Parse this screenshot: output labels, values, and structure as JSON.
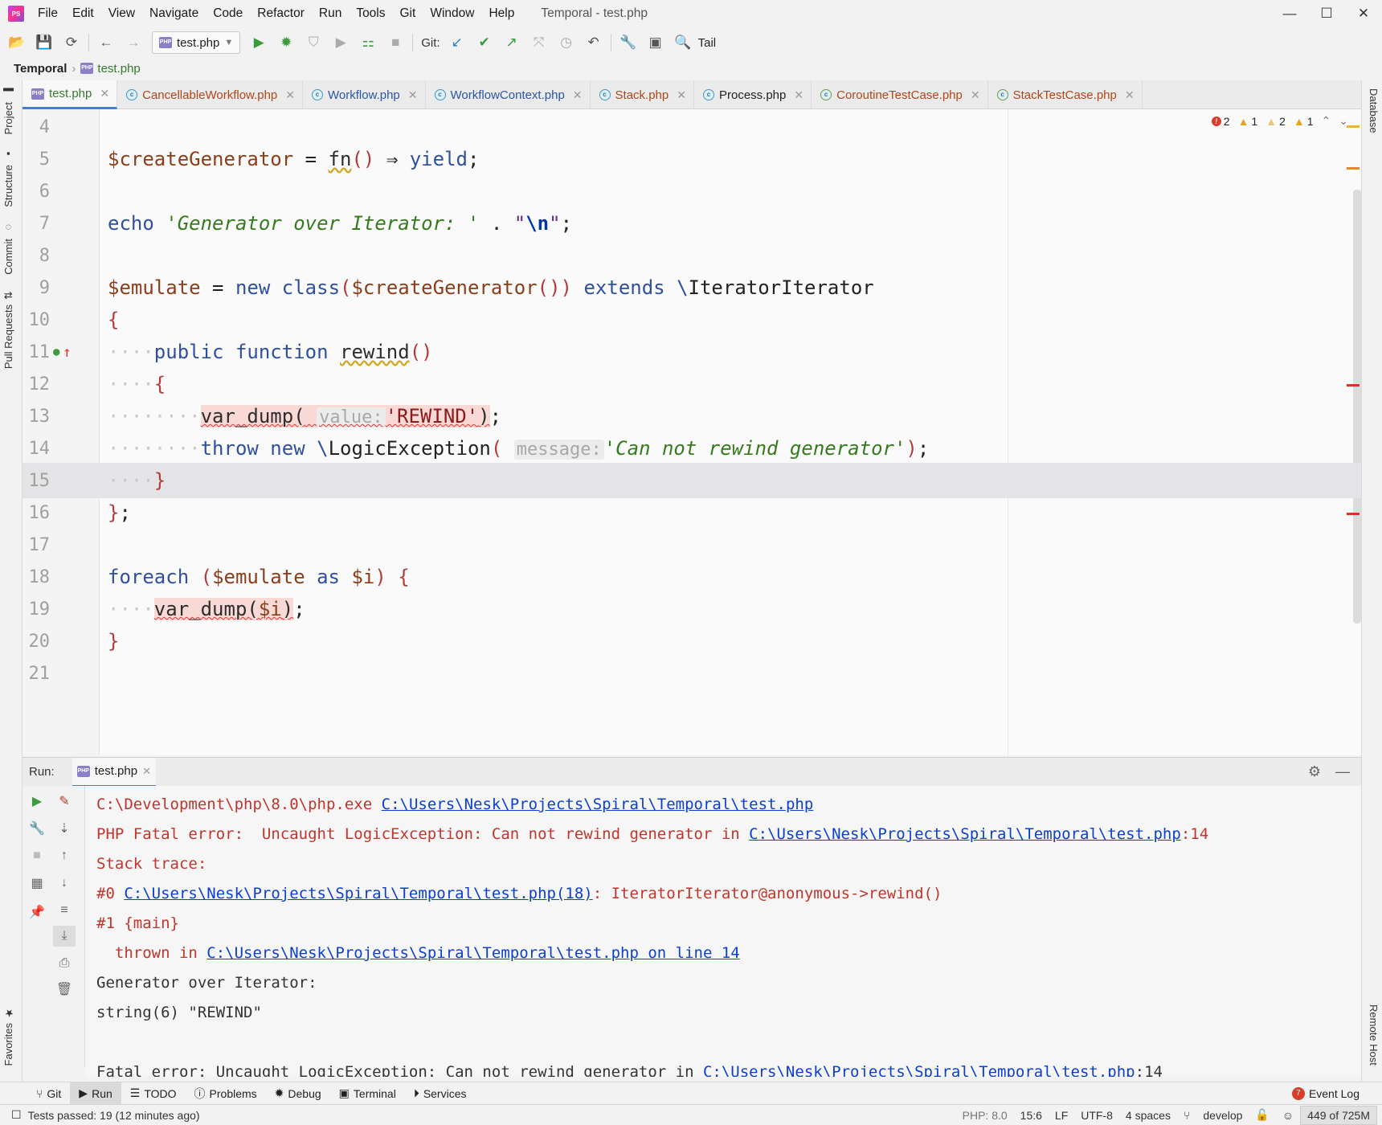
{
  "window": {
    "title": "Temporal - test.php",
    "minimize": "—",
    "maximize": "☐",
    "close": "✕"
  },
  "menu": [
    "File",
    "Edit",
    "View",
    "Navigate",
    "Code",
    "Refactor",
    "Run",
    "Tools",
    "Git",
    "Window",
    "Help"
  ],
  "toolbar": {
    "run_config": "test.php",
    "git_label": "Git:",
    "tail_label": "Tail"
  },
  "breadcrumb": {
    "project": "Temporal",
    "file": "test.php"
  },
  "left_tools": [
    "Project",
    "Structure",
    "Commit",
    "Pull Requests",
    "Favorites"
  ],
  "right_tools": [
    "Database",
    "Remote Host"
  ],
  "tabs": [
    {
      "label": "test.php",
      "color": "#357a2f"
    },
    {
      "label": "CancellableWorkflow.php",
      "color": "#b0461a"
    },
    {
      "label": "Workflow.php",
      "color": "#2a56a8"
    },
    {
      "label": "WorkflowContext.php",
      "color": "#2a56a8"
    },
    {
      "label": "Stack.php",
      "color": "#b0461a"
    },
    {
      "label": "Process.php",
      "color": "#222222"
    },
    {
      "label": "CoroutineTestCase.php",
      "color": "#b0461a"
    },
    {
      "label": "StackTestCase.php",
      "color": "#b0461a"
    }
  ],
  "inspections": {
    "errors": "2",
    "warn1": "1",
    "weak": "2",
    "warn2": "1"
  },
  "editor": {
    "line_numbers": [
      "4",
      "5",
      "6",
      "7",
      "8",
      "9",
      "10",
      "11",
      "12",
      "13",
      "14",
      "15",
      "16",
      "17",
      "18",
      "19",
      "20",
      "21"
    ],
    "hint_value": "value:",
    "hint_message": "message:"
  },
  "run": {
    "label": "Run:",
    "tab": "test.php",
    "console": {
      "l1_exe": "C:\\Development\\php\\8.0\\php.exe",
      "l1_path": "C:\\Users\\Nesk\\Projects\\Spiral\\Temporal\\test.php",
      "l2_text": "PHP Fatal error:  Uncaught LogicException: Can not rewind generator in ",
      "l2_path": "C:\\Users\\Nesk\\Projects\\Spiral\\Temporal\\test.php",
      "l2_suffix": ":14",
      "l3": "Stack trace:",
      "l4_prefix": "#0 ",
      "l4_path": "C:\\Users\\Nesk\\Projects\\Spiral\\Temporal\\test.php(18)",
      "l4_suffix": ": IteratorIterator@anonymous->rewind()",
      "l5": "#1 {main}",
      "l6_prefix": "  thrown in ",
      "l6_path": "C:\\Users\\Nesk\\Projects\\Spiral\\Temporal\\test.php on line 14",
      "l7": "Generator over Iterator:",
      "l8": "string(6) \"REWIND\"",
      "l9_text": "Fatal error: Uncaught LogicException: Can not rewind generator in ",
      "l9_path": "C:\\Users\\Nesk\\Projects\\Spiral\\Temporal\\test.php",
      "l9_suffix": ":14"
    }
  },
  "bottom_tools": [
    "Git",
    "Run",
    "TODO",
    "Problems",
    "Debug",
    "Terminal",
    "Services"
  ],
  "event_log": {
    "label": "Event Log",
    "count": "7"
  },
  "status": {
    "tests": "Tests passed: 19 (12 minutes ago)",
    "php": "PHP: 8.0",
    "position": "15:6",
    "line_sep": "LF",
    "encoding": "UTF-8",
    "indent": "4 spaces",
    "branch": "develop",
    "memory": "449 of 725M"
  }
}
